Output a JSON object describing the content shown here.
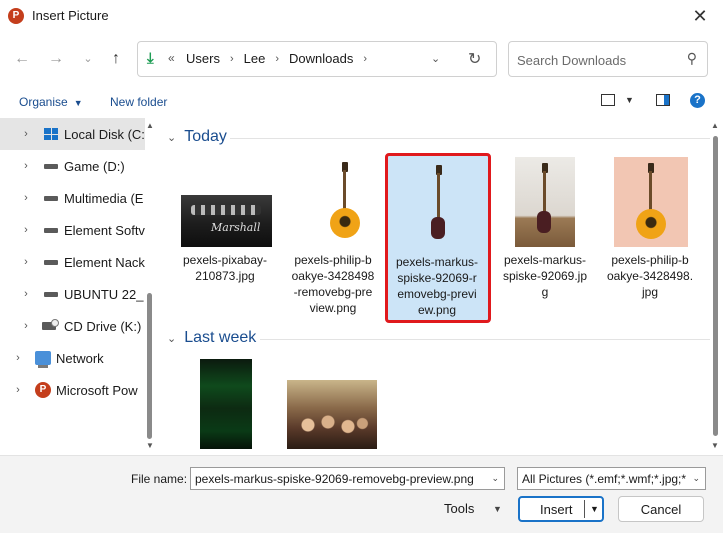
{
  "window": {
    "title": "Insert Picture",
    "app_icon_letter": "P",
    "close_glyph": "✕"
  },
  "nav": {
    "back_glyph": "←",
    "forward_glyph": "→",
    "recent_glyph": "⌄",
    "up_glyph": "↑",
    "crumb_prefix": "«",
    "crumbs": [
      "Users",
      "Lee",
      "Downloads"
    ],
    "search_placeholder": "Search Downloads"
  },
  "toolbar": {
    "organise_label": "Organise",
    "new_folder_label": "New folder",
    "help_glyph": "?"
  },
  "sidebar": {
    "items": [
      {
        "label": "Local Disk (C:",
        "icon": "local-disk-icon"
      },
      {
        "label": "Game (D:)",
        "icon": "drive-icon"
      },
      {
        "label": "Multimedia (E",
        "icon": "drive-icon"
      },
      {
        "label": "Element Softv",
        "icon": "drive-icon"
      },
      {
        "label": "Element Nack",
        "icon": "drive-icon"
      },
      {
        "label": "UBUNTU 22_",
        "icon": "drive-icon"
      },
      {
        "label": "CD Drive (K:)",
        "icon": "cd-drive-icon"
      },
      {
        "label": "Network",
        "icon": "network-icon"
      },
      {
        "label": "Microsoft Pow",
        "icon": "powerpoint-icon"
      }
    ]
  },
  "groups": [
    {
      "title": "Today",
      "files": [
        {
          "name": "pexels-pixabay-210873.jpg",
          "lines": [
            "pexels-pixabay-",
            "210873.jpg"
          ]
        },
        {
          "name": "pexels-philip-boakye-3428498-removebg-preview.png",
          "lines": [
            "pexels-philip-b",
            "oakye-3428498",
            "-removebg-pre",
            "view.png"
          ]
        },
        {
          "name": "pexels-markus-spiske-92069-removebg-preview.png",
          "lines": [
            "pexels-markus-",
            "spiske-92069-r",
            "emovebg-previ",
            "ew.png"
          ],
          "selected": true
        },
        {
          "name": "pexels-markus-spiske-92069.jpg",
          "lines": [
            "pexels-markus-",
            "spiske-92069.jp",
            "g"
          ]
        },
        {
          "name": "pexels-philip-boakye-3428498.jpg",
          "lines": [
            "pexels-philip-b",
            "oakye-3428498.",
            "jpg"
          ]
        }
      ]
    },
    {
      "title": "Last week",
      "files": []
    }
  ],
  "marshall_brand": "Marshall",
  "bottom": {
    "file_name_label": "File name:",
    "file_name_value": "pexels-markus-spiske-92069-removebg-preview.png",
    "filter_value": "All Pictures (*.emf;*.wmf;*.jpg;*",
    "tools_label": "Tools",
    "insert_label": "Insert",
    "cancel_label": "Cancel"
  }
}
